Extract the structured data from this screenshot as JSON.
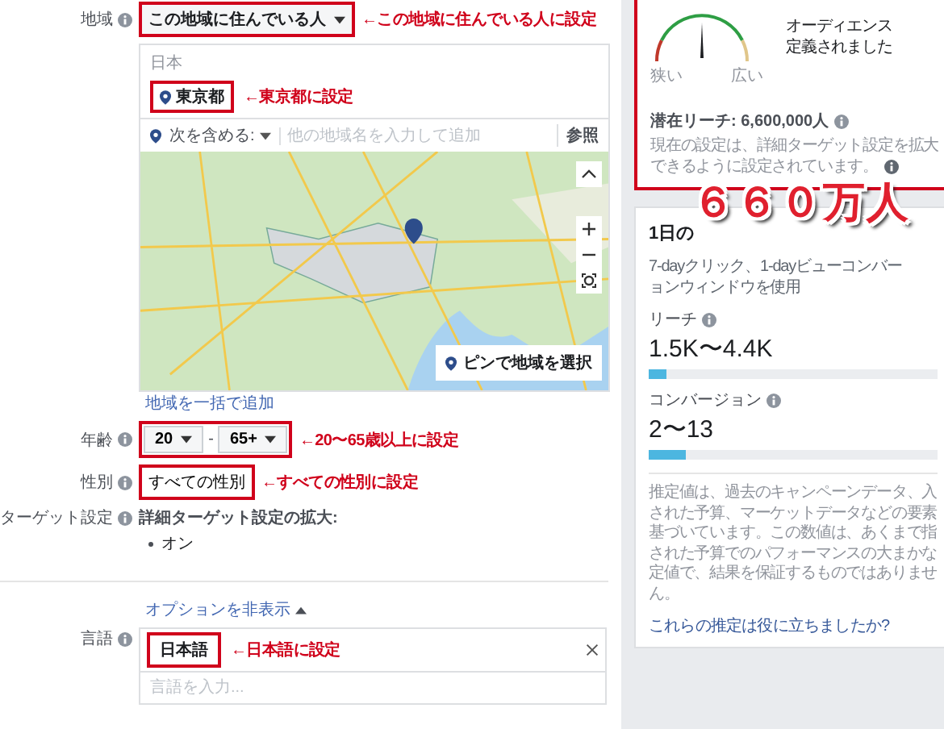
{
  "location": {
    "label": "地域",
    "mode": {
      "value": "この地域に住んでいる人",
      "note": "←この地域に住んでいる人に設定"
    },
    "country": "日本",
    "places": [
      {
        "name": "東京都",
        "note": "←東京都に設定"
      }
    ],
    "include": {
      "label": "次を含める:",
      "placeholder": "他の地域名を入力して追加",
      "browse": "参照"
    },
    "map": {
      "pin_button": "ピンで地域を選択"
    },
    "bulk_link": "地域を一括で追加"
  },
  "age": {
    "label": "年齢",
    "min": "20",
    "separator": "-",
    "max": "65+",
    "note": "←20〜65歳以上に設定"
  },
  "gender": {
    "label": "性別",
    "value": "すべての性別",
    "note": "←すべての性別に設定"
  },
  "detailed": {
    "label": "ターゲット設定",
    "title": "詳細ターゲット設定の拡大:",
    "items": [
      "オン"
    ]
  },
  "options_link": "オプションを非表示",
  "language": {
    "label": "言語",
    "chips": [
      {
        "name": "日本語",
        "note": "←日本語に設定"
      }
    ],
    "placeholder": "言語を入力..."
  },
  "audience": {
    "highlighted": true,
    "narrow": "狭い",
    "wide": "広い",
    "summary": [
      "オーディエンス",
      "定義されました"
    ],
    "reach": "潜在リーチ: 6,600,000人",
    "note_lines": [
      "現在の設定は、詳細ターゲット設定を拡大",
      "できるように設定されています。"
    ]
  },
  "callout": "６６０万人",
  "estimates": {
    "heading": "1日の",
    "window_lines": [
      "7-dayクリック、1-dayビューコンバー",
      "ョンウィンドウを使用"
    ],
    "metrics": [
      {
        "label": "リーチ",
        "value": "1.5K〜4.4K",
        "level": 0.06
      },
      {
        "label": "コンバージョン",
        "value": "2〜13",
        "level": 0.13
      }
    ],
    "disclaimer_lines": [
      "推定値は、過去のキャンペーンデータ、入",
      "された予算、マーケットデータなどの要素",
      "基づいています。この数値は、あくまで指",
      "された予算でのパフォーマンスの大まかな",
      "定値で、結果を保証するものではありませ",
      "ん。"
    ],
    "feedback_link": "これらの推定は役に立ちましたか?"
  }
}
